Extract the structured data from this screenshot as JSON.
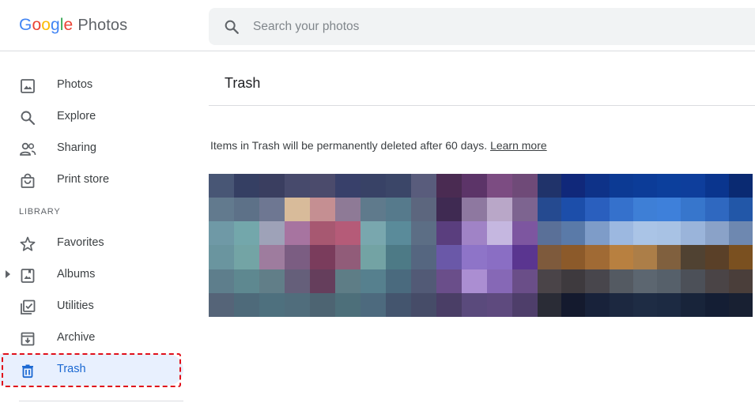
{
  "header": {
    "logo": {
      "letters": [
        "G",
        "o",
        "o",
        "g",
        "l",
        "e"
      ],
      "product": "Photos"
    },
    "search": {
      "placeholder": "Search your photos",
      "icon": "search-icon"
    }
  },
  "sidebar": {
    "items": [
      {
        "id": "photos",
        "label": "Photos",
        "icon": "photo-icon"
      },
      {
        "id": "explore",
        "label": "Explore",
        "icon": "search-icon"
      },
      {
        "id": "sharing",
        "label": "Sharing",
        "icon": "people-icon"
      },
      {
        "id": "print-store",
        "label": "Print store",
        "icon": "shopping-bag-icon"
      }
    ],
    "library_label": "LIBRARY",
    "library_items": [
      {
        "id": "favorites",
        "label": "Favorites",
        "icon": "star-icon"
      },
      {
        "id": "albums",
        "label": "Albums",
        "icon": "album-icon",
        "expandable": true
      },
      {
        "id": "utilities",
        "label": "Utilities",
        "icon": "checklist-icon"
      },
      {
        "id": "archive",
        "label": "Archive",
        "icon": "archive-icon"
      },
      {
        "id": "trash",
        "label": "Trash",
        "icon": "trash-icon",
        "active": true
      }
    ]
  },
  "main": {
    "title": "Trash",
    "notice": "Items in Trash will be permanently deleted after 60 days.",
    "learn_more": "Learn more"
  },
  "colors": {
    "accent": "#1967d2",
    "active_bg": "#e8f0fe",
    "highlight": "#e0101b",
    "search_bg": "#f1f3f4"
  },
  "photos": [
    {
      "cols": 9,
      "rows": 6,
      "pixels": [
        "#485675",
        "#353f63",
        "#3a3e60",
        "#474a6c",
        "#4b4b6c",
        "#38406a",
        "#384266",
        "#3b4668",
        "#595c7c",
        "#627a8e",
        "#5d7188",
        "#6e7792",
        "#d8bb9a",
        "#c58f92",
        "#8e7a96",
        "#5f7a8c",
        "#567a8c",
        "#5c667e",
        "#6f99a6",
        "#73a7ab",
        "#9ea2b8",
        "#a774a0",
        "#a75871",
        "#b55b78",
        "#79a7ae",
        "#5a8b9a",
        "#5c6e85",
        "#6a959f",
        "#73a4a5",
        "#9e7c9e",
        "#7b5d82",
        "#7a3c5c",
        "#915c79",
        "#73a3a4",
        "#4d7a86",
        "#556680",
        "#5e7e8c",
        "#5e8890",
        "#617e88",
        "#655f7a",
        "#653e5c",
        "#5e7d86",
        "#56808e",
        "#4a6a7e",
        "#525a76",
        "#556478",
        "#4e6a7a",
        "#4e707e",
        "#506d7c",
        "#4d6472",
        "#4d6f7a",
        "#4d6a7e",
        "#44556e",
        "#464c68"
      ]
    },
    {
      "cols": 4,
      "rows": 6,
      "pixels": [
        "#4a2b52",
        "#5c3468",
        "#7c4c82",
        "#6f4a78",
        "#3f2a52",
        "#8e78a0",
        "#b9a7c8",
        "#7d6490",
        "#5a3e7e",
        "#a083c6",
        "#c5b7e0",
        "#7d56a0",
        "#6a58a8",
        "#8e74c8",
        "#8a6ec4",
        "#5a3590",
        "#6a4e8a",
        "#ab8ed2",
        "#8668b6",
        "#6a4e88",
        "#4a3e66",
        "#5a4a7c",
        "#5e4a7e",
        "#4e3e6a"
      ]
    },
    {
      "cols": 9,
      "rows": 6,
      "pixels": [
        "#20336a",
        "#10287a",
        "#0e3288",
        "#0c3a94",
        "#0c3c98",
        "#0c3f9c",
        "#0e3e9c",
        "#0a358e",
        "#0a2a72",
        "#254a90",
        "#1c4eaa",
        "#2a5fbe",
        "#3571cc",
        "#3e7fd6",
        "#3e80da",
        "#3776cc",
        "#2f68c0",
        "#2257a8",
        "#5a7098",
        "#5a7aa8",
        "#7e9cc8",
        "#9cb8e0",
        "#aac4e6",
        "#a8c2e4",
        "#9ab4da",
        "#8aa2c8",
        "#6e88b0",
        "#7e5a3c",
        "#8c5a2a",
        "#a06a34",
        "#b88040",
        "#ac7e48",
        "#80603e",
        "#504232",
        "#5a4028",
        "#7a5020",
        "#4a4448",
        "#3e3a3e",
        "#48464c",
        "#545a62",
        "#5c6670",
        "#56606a",
        "#4c5058",
        "#4a4446",
        "#4a3e3a",
        "#2a2c36",
        "#141a2e",
        "#18223a",
        "#1c2840",
        "#1e2c44",
        "#1c2a42",
        "#18243a",
        "#141e34",
        "#182032"
      ]
    }
  ]
}
